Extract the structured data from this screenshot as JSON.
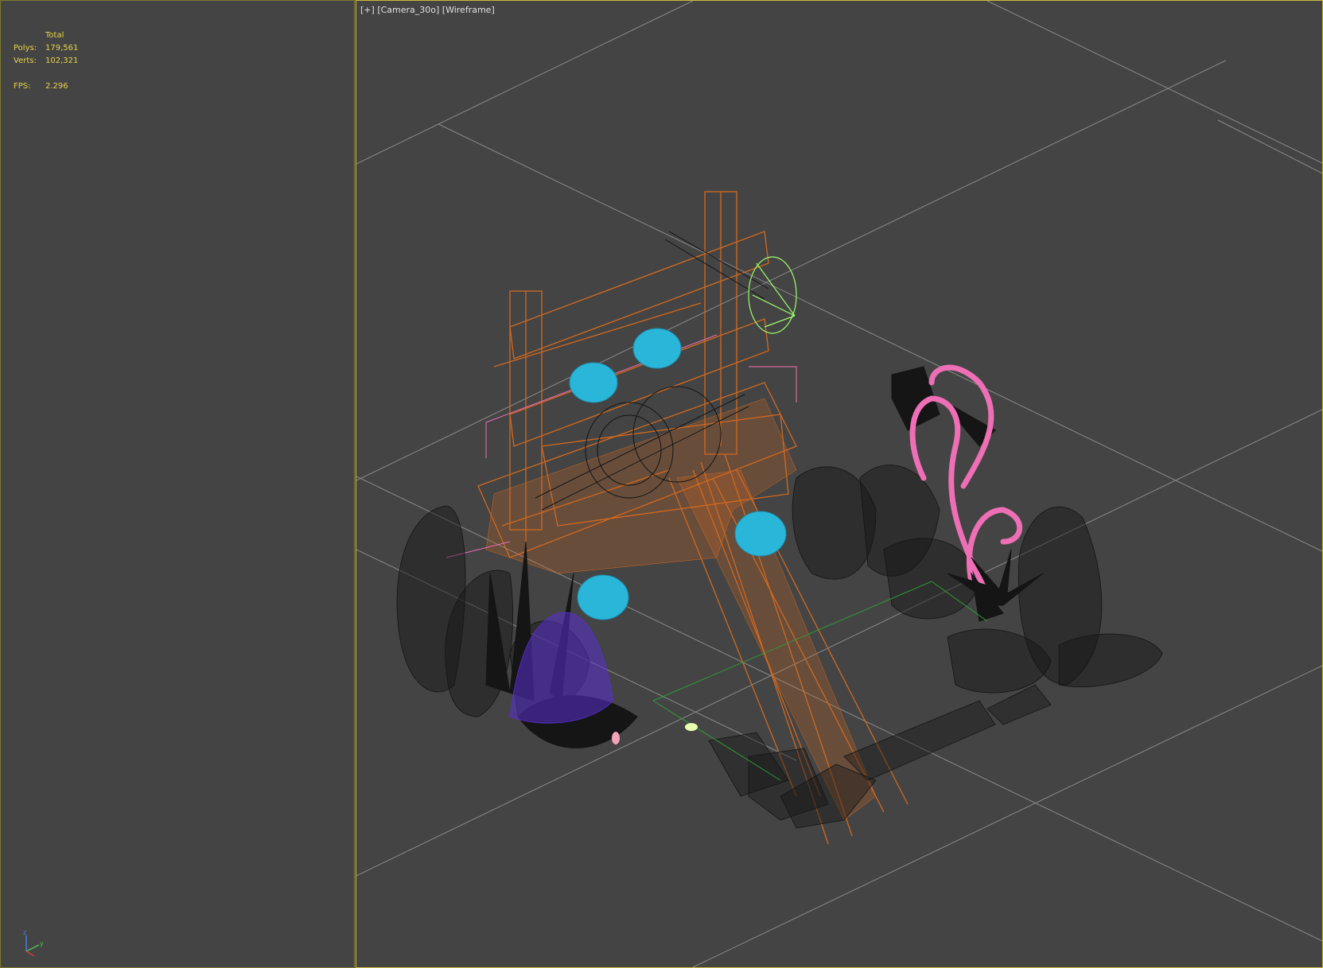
{
  "viewport": {
    "label_plus": "[+]",
    "label_camera": "[Camera_30o]",
    "label_mode": "[Wireframe]",
    "stats": {
      "header": "Total",
      "polys_label": "Polys:",
      "polys_value": "179,561",
      "verts_label": "Verts:",
      "verts_value": "102,321",
      "fps_label": "FPS:",
      "fps_value": "2.296"
    },
    "axis": {
      "z": "z",
      "y": "y"
    }
  },
  "colors": {
    "background": "#444444",
    "grid": "#8a8a8a",
    "active_border": "#c9b93a",
    "stats_text": "#e8d34a",
    "wire_orange": "#d2691e",
    "wire_cyan": "#29b6d8",
    "wire_pink": "#ee6fb5",
    "wire_green": "#9cff6a",
    "wire_purple": "#5a2fd0",
    "wire_black": "#1a1a1a"
  }
}
